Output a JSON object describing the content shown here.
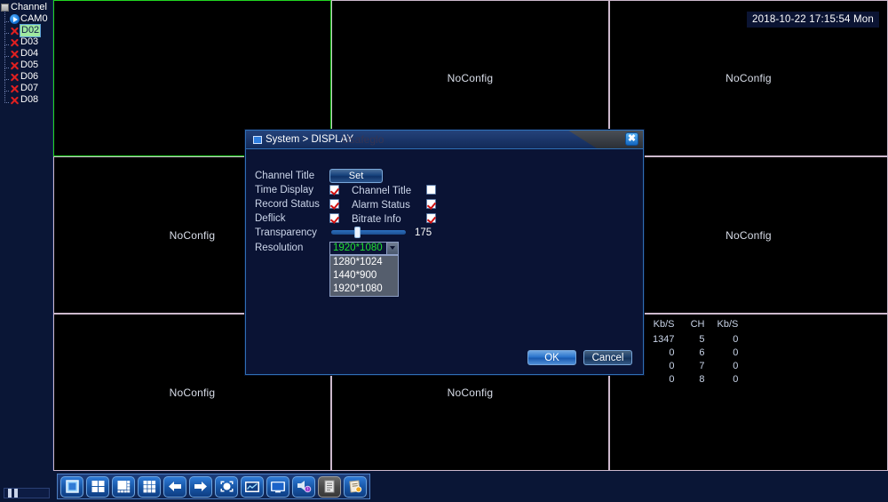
{
  "sidebar": {
    "root_label": "Channel",
    "items": [
      {
        "label": "CAM0",
        "icon": "camera-icon",
        "state": "online"
      },
      {
        "label": "D02",
        "icon": "x-icon",
        "state": "selected"
      },
      {
        "label": "D03",
        "icon": "x-icon",
        "state": "offline"
      },
      {
        "label": "D04",
        "icon": "x-icon",
        "state": "offline"
      },
      {
        "label": "D05",
        "icon": "x-icon",
        "state": "offline"
      },
      {
        "label": "D06",
        "icon": "x-icon",
        "state": "offline"
      },
      {
        "label": "D07",
        "icon": "x-icon",
        "state": "offline"
      },
      {
        "label": "D08",
        "icon": "x-icon",
        "state": "offline"
      }
    ]
  },
  "overlay": {
    "timestamp": "2018-10-22 17:15:54 Mon",
    "no_config_label": "NoConfig"
  },
  "wall": {
    "cells": [
      {
        "label": ""
      },
      {
        "label": "NoConfig"
      },
      {
        "label": "NoConfig"
      },
      {
        "label": "NoConfig"
      },
      {
        "label": ""
      },
      {
        "label": "NoConfig"
      },
      {
        "label": "NoConfig"
      },
      {
        "label": "NoConfig"
      },
      {
        "label": ""
      }
    ]
  },
  "stats": {
    "headers": [
      "Kb/S",
      "CH",
      "Kb/S"
    ],
    "rows": [
      [
        "1347",
        "5",
        "0"
      ],
      [
        "0",
        "6",
        "0"
      ],
      [
        "0",
        "7",
        "0"
      ],
      [
        "0",
        "8",
        "0"
      ]
    ]
  },
  "dialog": {
    "title": "System > DISPLAY",
    "watermark": "Usafeglo",
    "close_label": "✖",
    "fields": {
      "channel_title_label": "Channel Title",
      "set_button": "Set",
      "time_display_label": "Time Display",
      "time_display_checked": true,
      "channel_title_cb_label": "Channel Title",
      "channel_title_cb_checked": false,
      "record_status_label": "Record Status",
      "record_status_checked": true,
      "alarm_status_label": "Alarm Status",
      "alarm_status_checked": true,
      "deflick_label": "Deflick",
      "deflick_checked": true,
      "bitrate_info_label": "Bitrate Info",
      "bitrate_info_checked": true,
      "transparency_label": "Transparency",
      "transparency_value": "175",
      "resolution_label": "Resolution",
      "resolution_value": "1920*1080",
      "resolution_options": [
        "1280*1024",
        "1440*900",
        "1920*1080"
      ]
    },
    "ok_label": "OK",
    "cancel_label": "Cancel"
  },
  "toolbar": {
    "buttons": [
      {
        "name": "view-single-button",
        "icon": "single-view-icon"
      },
      {
        "name": "view-four-button",
        "icon": "four-split-icon"
      },
      {
        "name": "view-eight-button",
        "icon": "eight-split-icon"
      },
      {
        "name": "view-nine-button",
        "icon": "nine-split-icon"
      },
      {
        "name": "prev-page-button",
        "icon": "arrow-left-icon"
      },
      {
        "name": "next-page-button",
        "icon": "arrow-right-icon"
      },
      {
        "name": "ptz-button",
        "icon": "ptz-icon"
      },
      {
        "name": "color-setting-button",
        "icon": "chart-icon"
      },
      {
        "name": "display-button",
        "icon": "monitor-icon"
      },
      {
        "name": "alarm-output-button",
        "icon": "speaker-icon"
      },
      {
        "name": "record-button",
        "icon": "document-icon"
      },
      {
        "name": "main-menu-button",
        "icon": "menu-icon"
      }
    ]
  },
  "colors": {
    "accent": "#2f7bd6",
    "selected_cell_border": "#21d521",
    "offline_icon": "#e02020",
    "selected_value": "#22e033",
    "dialog_bg": "#0a1334"
  }
}
